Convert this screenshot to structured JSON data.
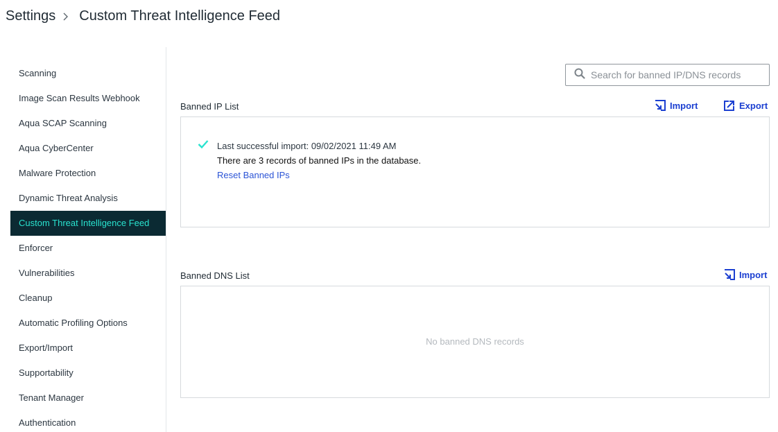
{
  "breadcrumb": {
    "root": "Settings",
    "current": "Custom Threat Intelligence Feed"
  },
  "sidebar": {
    "items": [
      {
        "label": "Scanning"
      },
      {
        "label": "Image Scan Results Webhook"
      },
      {
        "label": "Aqua SCAP Scanning"
      },
      {
        "label": "Aqua CyberCenter"
      },
      {
        "label": "Malware Protection"
      },
      {
        "label": "Dynamic Threat Analysis"
      },
      {
        "label": "Custom Threat Intelligence Feed",
        "active": true
      },
      {
        "label": "Enforcer"
      },
      {
        "label": "Vulnerabilities"
      },
      {
        "label": "Cleanup"
      },
      {
        "label": "Automatic Profiling Options"
      },
      {
        "label": "Export/Import"
      },
      {
        "label": "Supportability"
      },
      {
        "label": "Tenant Manager"
      },
      {
        "label": "Authentication"
      }
    ]
  },
  "search": {
    "placeholder": "Search for banned IP/DNS records",
    "icon": "search-icon"
  },
  "ip_list": {
    "title": "Banned IP List",
    "import_label": "Import",
    "export_label": "Export",
    "last_import": "Last successful import: 09/02/2021 11:49 AM",
    "records_text": "There are 3 records of banned IPs in the database.",
    "reset_label": "Reset Banned IPs"
  },
  "dns_list": {
    "title": "Banned DNS List",
    "import_label": "Import",
    "empty_text": "No banned DNS records"
  },
  "colors": {
    "accent_link": "#1b3fd1",
    "active_bg": "#0b2a33",
    "active_text": "#29e3cf",
    "success": "#29e3cf"
  }
}
